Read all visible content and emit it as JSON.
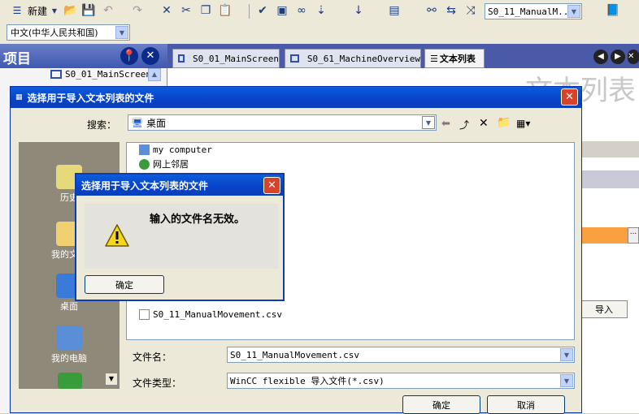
{
  "toolbar": {
    "new_label": "新建",
    "screen_combo": "S0_11_ManualM...",
    "language_combo": "中文(中华人民共和国)"
  },
  "project_panel": {
    "title": "项目",
    "tree_item": "S0_01_MainScreen"
  },
  "editor_tabs": [
    {
      "label": "S0_01_MainScreen"
    },
    {
      "label": "S0_61_MachineOverview"
    },
    {
      "label": "文本列表"
    }
  ],
  "background": {
    "watermark": "文本列表",
    "import_button": "导入"
  },
  "file_dialog": {
    "title": "选择用于导入文本列表的文件",
    "search_label": "搜索：",
    "search_location": "桌面",
    "places": [
      {
        "label": "历史"
      },
      {
        "label": "我的文档"
      },
      {
        "label": "桌面"
      },
      {
        "label": "我的电脑"
      }
    ],
    "files": [
      {
        "name": "my computer",
        "icon": "computer-icon"
      },
      {
        "name": "网上邻居",
        "icon": "network-icon"
      },
      {
        "name": "S0_11_ManualMovement.csv",
        "icon": "csv-file-icon"
      }
    ],
    "filename_label": "文件名：",
    "filename_value": "S0_11_ManualMovement.csv",
    "filetype_label": "文件类型：",
    "filetype_value": "WinCC flexible 导入文件(*.csv)",
    "ok_label": "确定",
    "cancel_label": "取消"
  },
  "alert": {
    "title": "选择用于导入文本列表的文件",
    "message": "输入的文件名无效。",
    "ok_label": "确定"
  },
  "colors": {
    "xp_title_blue": "#0a5ddb",
    "places_bar": "#8e8979",
    "warning_yellow": "#f7d617",
    "orange_row": "#f9a040"
  }
}
